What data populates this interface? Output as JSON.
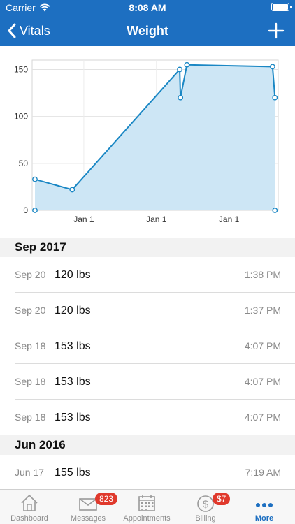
{
  "status_bar": {
    "carrier": "Carrier",
    "time": "8:08 AM"
  },
  "nav": {
    "back_label": "Vitals",
    "title": "Weight"
  },
  "chart_data": {
    "type": "area",
    "y_ticks": [
      "150",
      "100",
      "50",
      "0"
    ],
    "x_ticks": [
      "Jan 1",
      "Jan 1",
      "Jan 1"
    ],
    "ylim": [
      0,
      160
    ],
    "grid": true,
    "color": "#1a87c4",
    "fill_color": "#cde6f5",
    "points": [
      {
        "x": 0.0,
        "y": 33
      },
      {
        "x": 0.155,
        "y": 22
      },
      {
        "x": 0.602,
        "y": 150
      },
      {
        "x": 0.605,
        "y": 120
      },
      {
        "x": 0.632,
        "y": 155
      },
      {
        "x": 0.988,
        "y": 153
      },
      {
        "x": 0.998,
        "y": 120
      }
    ],
    "baseline_points": [
      0.0,
      0.998
    ]
  },
  "sections": [
    {
      "header": "Sep 2017",
      "rows": [
        {
          "date": "Sep 20",
          "value": "120 lbs",
          "time": "1:38 PM"
        },
        {
          "date": "Sep 20",
          "value": "120 lbs",
          "time": "1:37 PM"
        },
        {
          "date": "Sep 18",
          "value": "153 lbs",
          "time": "4:07 PM"
        },
        {
          "date": "Sep 18",
          "value": "153 lbs",
          "time": "4:07 PM"
        },
        {
          "date": "Sep 18",
          "value": "153 lbs",
          "time": "4:07 PM"
        }
      ]
    },
    {
      "header": "Jun 2016",
      "rows": [
        {
          "date": "Jun 17",
          "value": "155 lbs",
          "time": "7:19 AM"
        }
      ]
    }
  ],
  "tabs": [
    {
      "label": "Dashboard",
      "icon": "house-icon"
    },
    {
      "label": "Messages",
      "icon": "envelope-icon",
      "badge": "823"
    },
    {
      "label": "Appointments",
      "icon": "calendar-icon"
    },
    {
      "label": "Billing",
      "icon": "dollar-coin-icon",
      "badge": "$7"
    },
    {
      "label": "More",
      "icon": "ellipsis-icon",
      "active": true
    }
  ],
  "colors": {
    "brand": "#1d6fc1",
    "badge": "#e0392c"
  }
}
